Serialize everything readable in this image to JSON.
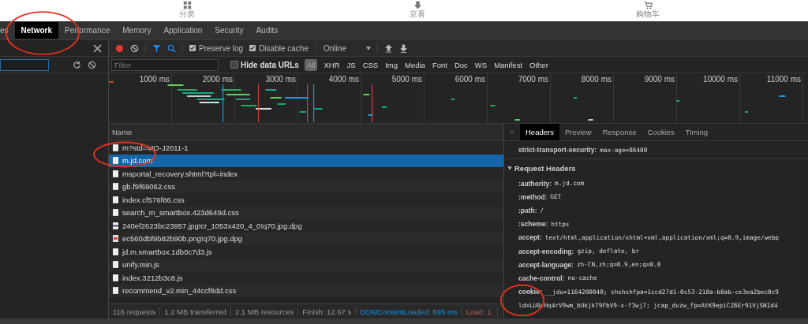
{
  "page_nav": [
    {
      "kind": "grid",
      "label": "分类"
    },
    {
      "kind": "download",
      "label": "京喜"
    },
    {
      "kind": "cart",
      "label": "购物车"
    }
  ],
  "tabs": [
    {
      "label": "es",
      "selected": false
    },
    {
      "label": "Network",
      "selected": true
    },
    {
      "label": "Performance",
      "selected": false
    },
    {
      "label": "Memory",
      "selected": false
    },
    {
      "label": "Application",
      "selected": false
    },
    {
      "label": "Security",
      "selected": false
    },
    {
      "label": "Audits",
      "selected": false
    }
  ],
  "toolbar": {
    "recording": true,
    "preserve_log": {
      "label": "Preserve log",
      "checked": true
    },
    "disable_cache": {
      "label": "Disable cache",
      "checked": true
    },
    "throttling": "Online"
  },
  "filter": {
    "placeholder": "Filter",
    "hide_data_urls": {
      "label": "Hide data URLs",
      "checked": false
    },
    "types": [
      {
        "label": "All",
        "selected": true
      },
      {
        "label": "XHR",
        "selected": false
      },
      {
        "label": "JS",
        "selected": false
      },
      {
        "label": "CSS",
        "selected": false
      },
      {
        "label": "Img",
        "selected": false
      },
      {
        "label": "Media",
        "selected": false
      },
      {
        "label": "Font",
        "selected": false
      },
      {
        "label": "Doc",
        "selected": false
      },
      {
        "label": "WS",
        "selected": false
      },
      {
        "label": "Manifest",
        "selected": false
      },
      {
        "label": "Other",
        "selected": false
      }
    ]
  },
  "timeline": {
    "ticks": [
      "1000 ms",
      "2000 ms",
      "3000 ms",
      "4000 ms",
      "5000 ms",
      "6000 ms",
      "7000 ms",
      "8000 ms",
      "9000 ms",
      "10000 ms",
      "11000 ms"
    ]
  },
  "requests": {
    "column": "Name",
    "rows": [
      {
        "name": "m?std=MO-J2011-1",
        "kind": "doc",
        "selected": false
      },
      {
        "name": "m.jd.com",
        "kind": "doc",
        "selected": true
      },
      {
        "name": "msportal_recovery.shtml?tpl=index",
        "kind": "doc",
        "selected": false
      },
      {
        "name": "gb.f9f69062.css",
        "kind": "doc",
        "selected": false
      },
      {
        "name": "index.cf576f86.css",
        "kind": "doc",
        "selected": false
      },
      {
        "name": "search_m_smartbox.423d649d.css",
        "kind": "doc",
        "selected": false
      },
      {
        "name": "240ef2623bc23957.jpg!cr_1053x420_4_0!q70.jpg.dpg",
        "kind": "photo",
        "selected": false
      },
      {
        "name": "ec560dbf9b82b90b.png!q70.jpg.dpg",
        "kind": "image",
        "selected": false
      },
      {
        "name": "jd.m.smartbox.1db0c7d3.js",
        "kind": "doc",
        "selected": false
      },
      {
        "name": "unify.min.js",
        "kind": "doc",
        "selected": false
      },
      {
        "name": "index.3212b3c8.js",
        "kind": "doc",
        "selected": false
      },
      {
        "name": "recommend_v2.min_44ccf8dd.css",
        "kind": "doc",
        "selected": false
      }
    ]
  },
  "status_bar": [
    {
      "text": "116 requests",
      "kind": "plain"
    },
    {
      "text": "1.2 MB transferred",
      "kind": "plain"
    },
    {
      "text": "2.1 MB resources",
      "kind": "plain"
    },
    {
      "text": "Finish: 12.67 s",
      "kind": "plain"
    },
    {
      "text": "DOMContentLoaded: 695 ms",
      "kind": "domready"
    },
    {
      "text": "Load: 1.",
      "kind": "load"
    }
  ],
  "details": {
    "close": "×",
    "tabs": [
      {
        "label": "Headers",
        "selected": true
      },
      {
        "label": "Preview",
        "selected": false
      },
      {
        "label": "Response",
        "selected": false
      },
      {
        "label": "Cookies",
        "selected": false
      },
      {
        "label": "Timing",
        "selected": false
      }
    ],
    "response_header": {
      "name": "strict-transport-security:",
      "value": "max-age=86400"
    },
    "section": {
      "title": "Request Headers",
      "expanded": true
    },
    "headers": [
      {
        "name": ":authority:",
        "value": "m.jd.com"
      },
      {
        "name": ":method:",
        "value": "GET"
      },
      {
        "name": ":path:",
        "value": "/"
      },
      {
        "name": ":scheme:",
        "value": "https"
      },
      {
        "name": "accept:",
        "value": "text/html,application/xhtml+xml,application/xml;q=0.9,image/webp"
      },
      {
        "name": "accept-encoding:",
        "value": "gzip, deflate, br"
      },
      {
        "name": "accept-language:",
        "value": "zh-CN,zh;q=0.9,en;q=0.8"
      },
      {
        "name": "cache-control:",
        "value": "no-cache"
      },
      {
        "name": "cookie:",
        "value": "__jdu=1164200040; shshshfpa=1ccd27d1-0c53-218a-b8ab-ce3ea2bec0c9"
      }
    ],
    "continuation": "ld=LU8cHq4rV9wm_bUkjkT9FbV9-x-f3wj7; jcap_dvzw_fp=AtK9epiCZ6Er91VjSNId4"
  }
}
